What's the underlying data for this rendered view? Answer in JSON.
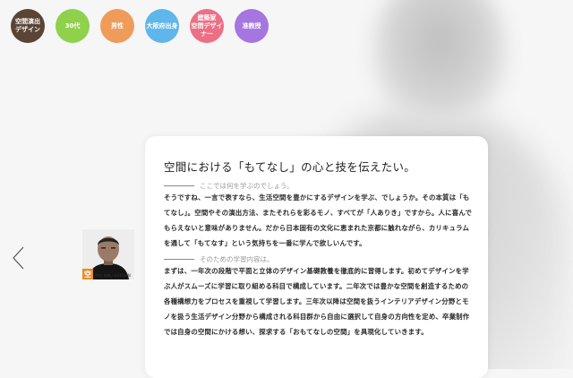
{
  "tags": [
    {
      "text": "空間演出\nデザイン",
      "color": "#5a4435"
    },
    {
      "text": "30代",
      "color": "#8fd14a"
    },
    {
      "text": "男性",
      "color": "#ef9c5a"
    },
    {
      "text": "大阪府出身",
      "color": "#5fb6ea"
    },
    {
      "text": "建築家\n空間デザイナー",
      "color": "#ec6f85"
    },
    {
      "text": "准教授",
      "color": "#a576e0"
    }
  ],
  "avatar": {
    "badge": "空",
    "caption": "中村 直樹 / ©KEISAN"
  },
  "card": {
    "title": "空間における「もてなし」の心と技を伝えたい。",
    "q1": "ここでは何を学ぶのでしょう。",
    "a1": "そうですね、一言で表すなら、生活空間を豊かにするデザインを学ぶ、でしょうか。その本質は「もてなし」。空間やその演出方法、またそれらを彩るモノ、すべてが「人ありき」ですから。人に喜んでもらえないと意味がありません。だから日本固有の文化に恵まれた京都に触れながら、カリキュラムを通して「もてなす」という気持ちを一番に学んで欲しいんです。",
    "q2": "そのための学習内容は。",
    "a2": "まずは、一年次の段階で平面と立体のデザイン基礎教養を徹底的に習得します。初めてデザインを学ぶ人がスムーズに学習に取り組める科目で構成しています。二年次では豊かな空間を創造するための各種構想力をプロセスを重視して学習します。三年次以降は空間を扱うインテリアデザイン分野とモノを扱う生活デザイン分野から構成される科目群から自由に選択して自身の方向性を定め、卒業制作では自身の空間にかける想い、探求する「おもてなしの空間」を具現化していきます。"
  }
}
